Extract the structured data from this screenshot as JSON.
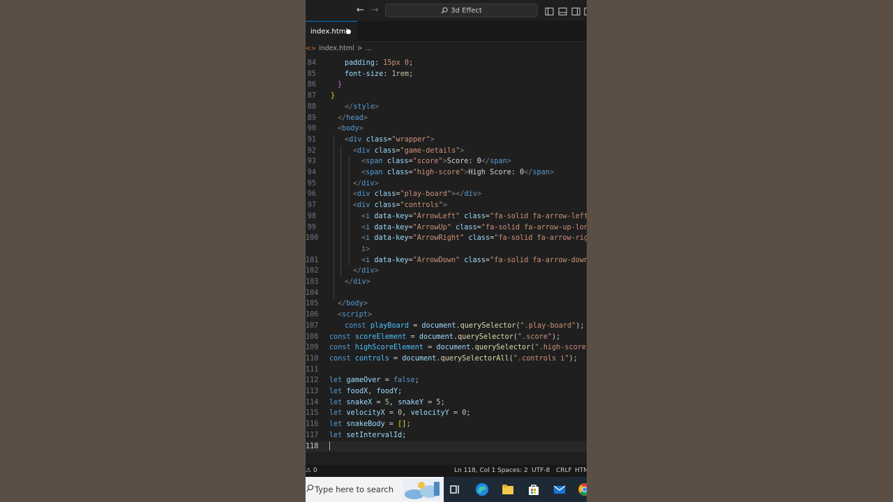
{
  "titlebar": {
    "back_icon": "arrow-left-icon",
    "forward_icon": "arrow-right-icon",
    "search_label": "3d Effect",
    "layout_icons": [
      "sidebar-left-icon",
      "panel-bottom-icon",
      "sidebar-right-icon",
      "layout-customize-icon"
    ]
  },
  "tab": {
    "label": "index.html",
    "modified": true
  },
  "breadcrumb": {
    "file": "index.html",
    "separator": ">",
    "rest": "..."
  },
  "editor": {
    "lines": [
      {
        "n": "84",
        "html": "<span class=\"a\">padding</span>: <span class=\"s\">15px 0</span>;"
      },
      {
        "n": "85",
        "html": "<span class=\"a\">font-size</span>: <span class=\"n\">1rem</span>;"
      },
      {
        "n": "86",
        "html": "<span class=\"p\">}</span>"
      },
      {
        "n": "87",
        "html": "<span class=\"b\">}</span>"
      },
      {
        "n": "88",
        "html": "<span class=\"gr\">&lt;/</span><span class=\"t\">style</span><span class=\"gr\">&gt;</span>"
      },
      {
        "n": "89",
        "html": "<span class=\"gr\">&lt;/</span><span class=\"t\">head</span><span class=\"gr\">&gt;</span>"
      },
      {
        "n": "90",
        "html": "<span class=\"gr\">&lt;</span><span class=\"t\">body</span><span class=\"gr\">&gt;</span>"
      },
      {
        "n": "91",
        "html": "<span class=\"gr\">&lt;</span><span class=\"t\">div</span> <span class=\"a\">class</span>=<span class=\"s\">\"wrapper\"</span><span class=\"gr\">&gt;</span>"
      },
      {
        "n": "92",
        "html": "<span class=\"gr\">&lt;</span><span class=\"t\">div</span> <span class=\"a\">class</span>=<span class=\"s\">\"game-details\"</span><span class=\"gr\">&gt;</span>"
      },
      {
        "n": "93",
        "html": "<span class=\"gr\">&lt;</span><span class=\"t\">span</span> <span class=\"a\">class</span>=<span class=\"s\">\"score\"</span><span class=\"gr\">&gt;</span><span class=\"tx\">Score: 0</span><span class=\"gr\">&lt;/</span><span class=\"t\">span</span><span class=\"gr\">&gt;</span>"
      },
      {
        "n": "94",
        "html": "<span class=\"gr\">&lt;</span><span class=\"t\">span</span> <span class=\"a\">class</span>=<span class=\"s\">\"high-score\"</span><span class=\"gr\">&gt;</span><span class=\"tx\">High Score: 0</span><span class=\"gr\">&lt;/</span><span class=\"t\">span</span><span class=\"gr\">&gt;</span>"
      },
      {
        "n": "95",
        "html": "<span class=\"gr\">&lt;/</span><span class=\"t\">div</span><span class=\"gr\">&gt;</span>"
      },
      {
        "n": "96",
        "html": "<span class=\"gr\">&lt;</span><span class=\"t\">div</span> <span class=\"a\">class</span>=<span class=\"s\">\"play-board\"</span><span class=\"gr\">&gt;&lt;/</span><span class=\"t\">div</span><span class=\"gr\">&gt;</span>"
      },
      {
        "n": "97",
        "html": "<span class=\"gr\">&lt;</span><span class=\"t\">div</span> <span class=\"a\">class</span>=<span class=\"s\">\"controls\"</span><span class=\"gr\">&gt;</span>"
      },
      {
        "n": "98",
        "html": "<span class=\"gr\">&lt;</span><span class=\"t\">i</span> <span class=\"a\">data-key</span>=<span class=\"s\">\"ArrowLeft\"</span> <span class=\"a\">class</span>=<span class=\"s\">\"fa-solid fa-arrow-left-lo</span>"
      },
      {
        "n": "99",
        "html": "<span class=\"gr\">&lt;</span><span class=\"t\">i</span> <span class=\"a\">data-key</span>=<span class=\"s\">\"ArrowUp\"</span> <span class=\"a\">class</span>=<span class=\"s\">\"fa-solid fa-arrow-up-long\"</span><span class=\"gr\">&gt;</span>"
      },
      {
        "n": "100",
        "html": "<span class=\"gr\">&lt;</span><span class=\"t\">i</span> <span class=\"a\">data-key</span>=<span class=\"s\">\"ArrowRight\"</span> <span class=\"a\">class</span>=<span class=\"s\">\"fa-solid fa-arrow-right-l</span>"
      },
      {
        "n": "",
        "html": "<span class=\"t\">i</span><span class=\"gr\">&gt;</span>"
      },
      {
        "n": "101",
        "html": "<span class=\"gr\">&lt;</span><span class=\"t\">i</span> <span class=\"a\">data-key</span>=<span class=\"s\">\"ArrowDown\"</span> <span class=\"a\">class</span>=<span class=\"s\">\"fa-solid fa-arrow-down-lo</span>"
      },
      {
        "n": "102",
        "html": "<span class=\"gr\">&lt;/</span><span class=\"t\">div</span><span class=\"gr\">&gt;</span>"
      },
      {
        "n": "103",
        "html": "<span class=\"gr\">&lt;/</span><span class=\"t\">div</span><span class=\"gr\">&gt;</span>"
      },
      {
        "n": "104",
        "html": ""
      },
      {
        "n": "105",
        "html": "<span class=\"gr\">&lt;/</span><span class=\"t\">body</span><span class=\"gr\">&gt;</span>"
      },
      {
        "n": "106",
        "html": "<span class=\"gr\">&lt;</span><span class=\"t\">script</span><span class=\"gr\">&gt;</span>"
      },
      {
        "n": "107",
        "html": "<span class=\"k\">const</span> <span class=\"c\">playBoard</span> = <span class=\"v\">document</span>.<span class=\"y\">querySelector</span>(<span class=\"s\">\".play-board\"</span>);"
      },
      {
        "n": "108",
        "html": "<span class=\"k\">const</span> <span class=\"c\">scoreElement</span> = <span class=\"v\">document</span>.<span class=\"y\">querySelector</span>(<span class=\"s\">\".score\"</span>);"
      },
      {
        "n": "109",
        "html": "<span class=\"k\">const</span> <span class=\"c\">highScoreElement</span> = <span class=\"v\">document</span>.<span class=\"y\">querySelector</span>(<span class=\"s\">\".high-score\"</span>);"
      },
      {
        "n": "110",
        "html": "<span class=\"k\">const</span> <span class=\"c\">controls</span> = <span class=\"v\">document</span>.<span class=\"y\">querySelectorAll</span>(<span class=\"s\">\".controls i\"</span>);"
      },
      {
        "n": "111",
        "html": ""
      },
      {
        "n": "112",
        "html": "<span class=\"k\">let</span> <span class=\"v\">gameOver</span> = <span class=\"k\">false</span>;"
      },
      {
        "n": "113",
        "html": "<span class=\"k\">let</span> <span class=\"v\">foodX</span>, <span class=\"v\">foodY</span>;"
      },
      {
        "n": "114",
        "html": "<span class=\"k\">let</span> <span class=\"v\">snakeX</span> = <span class=\"n\">5</span>, <span class=\"v\">snakeY</span> = <span class=\"n\">5</span>;"
      },
      {
        "n": "115",
        "html": "<span class=\"k\">let</span> <span class=\"v\">velocityX</span> = <span class=\"n\">0</span>, <span class=\"v\">velocityY</span> = <span class=\"n\">0</span>;"
      },
      {
        "n": "116",
        "html": "<span class=\"k\">let</span> <span class=\"v\">snakeBody</span> = <span class=\"b\">[]</span>;"
      },
      {
        "n": "117",
        "html": "<span class=\"k\">let</span> <span class=\"v\">setIntervalId</span>;"
      },
      {
        "n": "118",
        "html": "<span class=\"cursor\"></span>"
      }
    ],
    "active_line": "118"
  },
  "statusbar": {
    "problems": "0",
    "warning_icon": "warning-icon",
    "position": "Ln 118, Col 1",
    "spaces": "Spaces: 2",
    "encoding": "UTF-8",
    "eol": "CRLF",
    "language": "HTML"
  },
  "taskbar": {
    "search_placeholder": "Type here to search",
    "icons": [
      "task-view-icon",
      "edge-icon",
      "file-explorer-icon",
      "store-icon",
      "mail-icon",
      "chrome-icon"
    ]
  },
  "colors": {
    "editor_bg": "#1f1f1f",
    "accent": "#0078d4",
    "backdrop": "#5b4f45"
  }
}
